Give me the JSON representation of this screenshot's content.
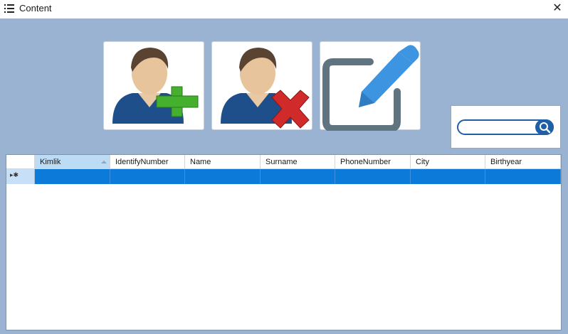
{
  "window": {
    "title": "Content",
    "close_glyph": "✕"
  },
  "toolbar": {
    "buttons": [
      {
        "name": "add-user-button",
        "icon": "add-user-icon"
      },
      {
        "name": "delete-user-button",
        "icon": "delete-user-icon"
      },
      {
        "name": "edit-button",
        "icon": "edit-icon"
      }
    ]
  },
  "search": {
    "value": "",
    "icon": "search-icon"
  },
  "grid": {
    "columns": [
      "Kimlik",
      "IdentifyNumber",
      "Name",
      "Surname",
      "PhoneNumber",
      "City",
      "Birthyear"
    ],
    "sorted_column": "Kimlik",
    "new_row_glyph": "▸✱",
    "selection_color": "#0c7ad9"
  }
}
